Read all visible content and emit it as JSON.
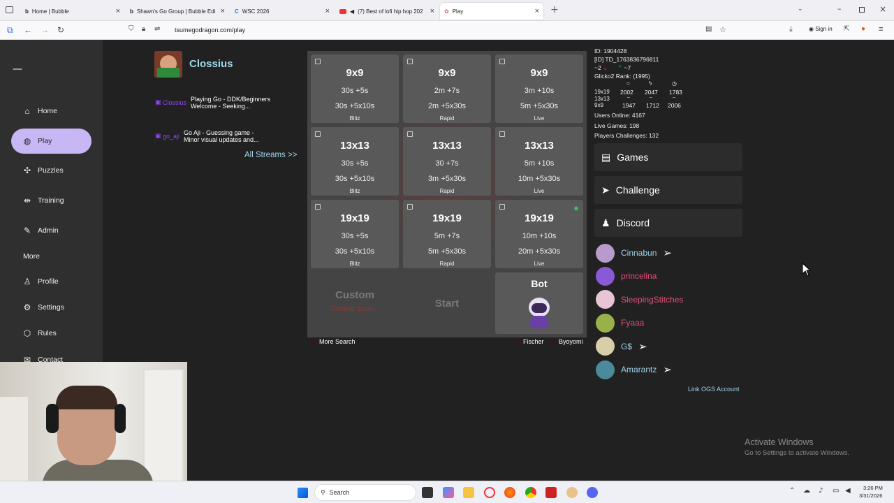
{
  "browser": {
    "tabs": [
      {
        "label": "Home | Bubble"
      },
      {
        "label": "Shawn's Go Group | Bubble Edi"
      },
      {
        "label": "WSC 2026"
      },
      {
        "label": "(7) Best of lofi hip hop 202"
      },
      {
        "label": "Play"
      }
    ],
    "url": "tsumegodragon.com/play",
    "signin_label": "Sign in"
  },
  "sidebar": {
    "logo": "—",
    "items": [
      {
        "label": "Home",
        "icon": "home-icon"
      },
      {
        "label": "Play",
        "icon": "globe-icon"
      },
      {
        "label": "Puzzles",
        "icon": "puzzle-icon"
      },
      {
        "label": "Training",
        "icon": "dumbbell-icon"
      },
      {
        "label": "Admin",
        "icon": "wrench-icon"
      },
      {
        "label": "More",
        "icon": ""
      },
      {
        "label": "Profile",
        "icon": "user-icon"
      },
      {
        "label": "Settings",
        "icon": "gear-icon"
      },
      {
        "label": "Rules",
        "icon": "rules-icon"
      },
      {
        "label": "Contact",
        "icon": "mail-icon"
      }
    ]
  },
  "streams": {
    "featured_name": "Clossius",
    "items": [
      {
        "user": "Clossius",
        "line1": "Playing Go - DDK/Beginners",
        "line2": "Welcome - Seeking..."
      },
      {
        "user": "go_aji",
        "line1": "Go Aji - Guessing game -",
        "line2": "Minor visual updates and..."
      }
    ],
    "all_streams": "All Streams >>"
  },
  "games": [
    {
      "size": "9x9",
      "t1": "30s +5s",
      "t2": "30s +5x10s",
      "kind": "Blitz"
    },
    {
      "size": "9x9",
      "t1": "2m +7s",
      "t2": "2m +5x30s",
      "kind": "Rapid"
    },
    {
      "size": "9x9",
      "t1": "3m +10s",
      "t2": "5m +5x30s",
      "kind": "Live"
    },
    {
      "size": "13x13",
      "t1": "30s +5s",
      "t2": "30s +5x10s",
      "kind": "Blitz"
    },
    {
      "size": "13x13",
      "t1": "30 +7s",
      "t2": "3m +5x30s",
      "kind": "Rapid"
    },
    {
      "size": "13x13",
      "t1": "5m +10s",
      "t2": "10m +5x30s",
      "kind": "Live"
    },
    {
      "size": "19x19",
      "t1": "30s +5s",
      "t2": "30s +5x10s",
      "kind": "Blitz"
    },
    {
      "size": "19x19",
      "t1": "5m +7s",
      "t2": "5m +5x30s",
      "kind": "Rapid"
    },
    {
      "size": "19x19",
      "t1": "10m +10s",
      "t2": "20m +5x30s",
      "kind": "Live"
    }
  ],
  "bottom": {
    "custom": "Custom",
    "coming_soon": "Coming Soon...",
    "start": "Start",
    "bot": "Bot",
    "more_search": "More Search",
    "fischer": "Fischer",
    "byoyomi": "Byoyomi"
  },
  "stats": {
    "id": "ID: 1904428",
    "tid": "[ID] TD_1763836796811",
    "trend_down": "~2",
    "trend_up": "~7",
    "glicko": "Glicko2 Rank: (1995)",
    "rows": [
      {
        "label": "19x19",
        "a": "2002",
        "b": "2047",
        "c": "1783"
      },
      {
        "label": "13x13",
        "a": "–",
        "b": "–",
        "c": "–"
      },
      {
        "label": "9x9",
        "a": "1947",
        "b": "1712",
        "c": "2006"
      }
    ],
    "users_online": "Users Online: 4167",
    "live_games": "Live Games: 198",
    "players_challenges": "Players Challenges: 132"
  },
  "panel_buttons": [
    {
      "label": "Games",
      "icon": "book-icon"
    },
    {
      "label": "Challenge",
      "icon": "paper-plane-icon"
    },
    {
      "label": "Discord",
      "icon": "users-icon"
    }
  ],
  "friends": [
    {
      "name": "Cinnabun",
      "color": "#9fd0e8",
      "send": true
    },
    {
      "name": "princelina",
      "color": "#e0507a",
      "send": false
    },
    {
      "name": "SleepingStitches",
      "color": "#e0507a",
      "send": false
    },
    {
      "name": "Fyaaa",
      "color": "#e0507a",
      "send": false
    },
    {
      "name": "G$",
      "color": "#9fd0e8",
      "send": true
    },
    {
      "name": "Amarantz",
      "color": "#9fd0e8",
      "send": true
    }
  ],
  "link_ogs": "Link OGS Account",
  "watermark": {
    "line1": "Activate Windows",
    "line2": "Go to Settings to activate Windows."
  },
  "taskbar": {
    "search": "Search",
    "time": "3:26 PM",
    "date": "3/31/2026"
  }
}
